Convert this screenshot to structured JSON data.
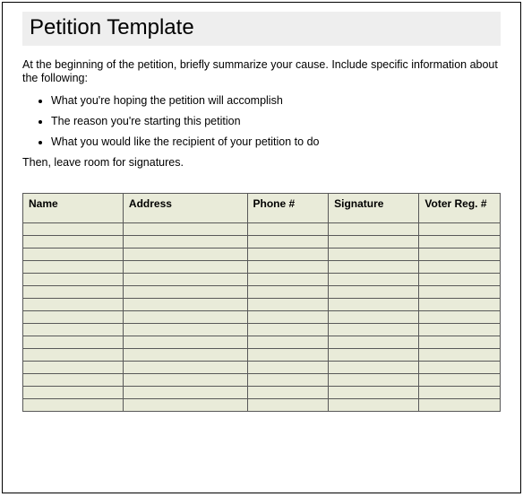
{
  "header": {
    "title": "Petition Template"
  },
  "intro": "At the beginning of the petition, briefly summarize your cause. Include specific information about the following:",
  "bullets": [
    "What you're hoping the petition will accomplish",
    "The reason you're starting this petition",
    "What you would like the recipient of your petition to do"
  ],
  "closing": "Then, leave room for signatures.",
  "table": {
    "columns": [
      "Name",
      "Address",
      "Phone #",
      "Signature",
      "Voter Reg. #"
    ],
    "row_count": 15
  }
}
